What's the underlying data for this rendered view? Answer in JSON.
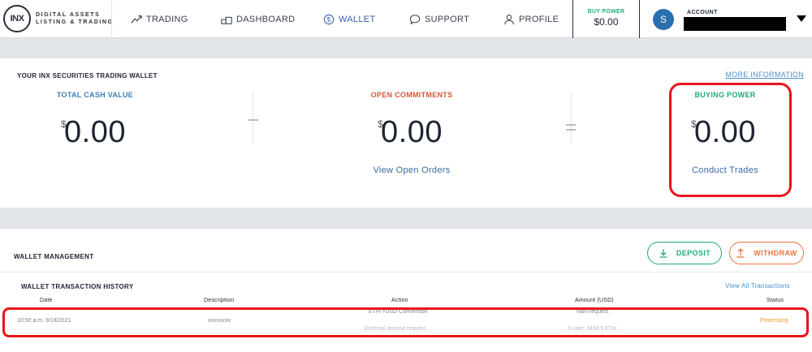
{
  "logo": {
    "mark": "INX",
    "line1": "DIGITAL ASSETS",
    "line2": "LISTING & TRADING"
  },
  "nav": {
    "trading": "TRADING",
    "dashboard": "DASHBOARD",
    "wallet": "WALLET",
    "support": "SUPPORT",
    "profile": "PROFILE"
  },
  "header": {
    "buy_power_label": "BUY POWER",
    "buy_power_value": "$0.00",
    "avatar_initial": "S",
    "account_label": "ACCOUNT"
  },
  "wallet": {
    "title": "YOUR INX SECURITIES TRADING WALLET",
    "more_info": "MORE INFORMATION",
    "total_cash": {
      "label": "TOTAL CASH VALUE",
      "currency": "$",
      "value": "0.00"
    },
    "open_commitments": {
      "label": "OPEN COMMITMENTS",
      "currency": "$",
      "value": "0.00",
      "link": "View Open Orders"
    },
    "buying_power": {
      "label": "BUYING POWER",
      "currency": "$",
      "value": "0.00",
      "link": "Conduct Trades"
    }
  },
  "management": {
    "title": "WALLET MANAGEMENT",
    "deposit": "DEPOSIT",
    "withdraw": "WITHDRAW",
    "history_title": "WALLET TRANSACTION HISTORY",
    "view_all": "View All Transactions",
    "columns": {
      "date": "Date",
      "description": "Description",
      "action": "Action",
      "amount": "Amount (USD)",
      "status": "Status"
    },
    "rows": [
      {
        "date": "10:50 a.m. 9/18/2021",
        "description": "xxxxxxxx",
        "action_primary": "ETH->USD Conversion",
        "action_secondary": "External deposit request",
        "amount_primary": "NaN request",
        "amount_secondary": "X-rate: 3458.5 ETH",
        "status": "Processing"
      }
    ]
  },
  "colors": {
    "accent_blue": "#3b5eb0",
    "green": "#1fa97c",
    "orange": "#e8733a",
    "red_open": "#d9563a",
    "highlight": "#e8141c"
  },
  "icons": [
    "trend-line-icon",
    "dashboard-icon",
    "dollar-circle-icon",
    "chat-bubble-icon",
    "user-icon",
    "caret-down-icon",
    "download-arrow-icon",
    "upload-arrow-icon"
  ]
}
